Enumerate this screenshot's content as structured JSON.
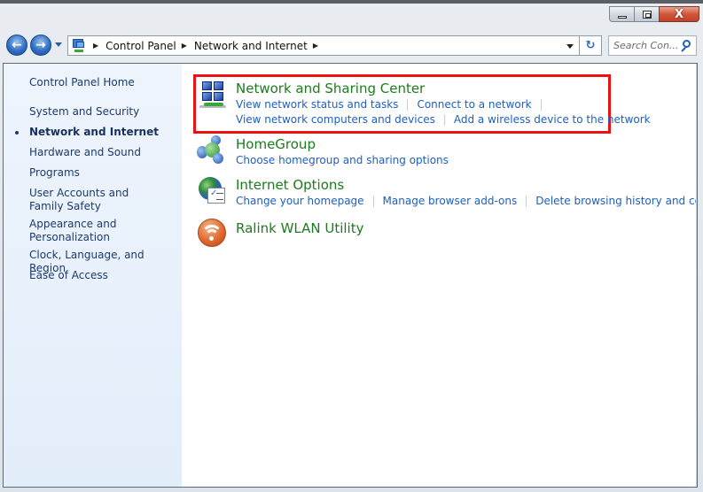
{
  "window": {
    "controls": {
      "minimize_label": "Minimize",
      "maximize_label": "Restore",
      "close_label": "Close",
      "close_glyph": "X"
    }
  },
  "navigation": {
    "back_glyph": "←",
    "forward_glyph": "→",
    "breadcrumb": [
      "Control Panel",
      "Network and Internet"
    ],
    "separator_glyph": "▶",
    "refresh_glyph": "↻",
    "search_placeholder": "Search Con..."
  },
  "sidebar": {
    "items": [
      {
        "label": "Control Panel Home",
        "active": false
      },
      {
        "label": "System and Security",
        "active": false
      },
      {
        "label": "Network and Internet",
        "active": true
      },
      {
        "label": "Hardware and Sound",
        "active": false
      },
      {
        "label": "Programs",
        "active": false
      },
      {
        "label": "User Accounts and Family Safety",
        "active": false
      },
      {
        "label": "Appearance and Personalization",
        "active": false
      },
      {
        "label": "Clock, Language, and Region",
        "active": false
      },
      {
        "label": "Ease of Access",
        "active": false
      }
    ]
  },
  "categories": [
    {
      "title": "Network and Sharing Center",
      "icon": "network-sharing-icon",
      "highlighted": true,
      "task_rows": [
        [
          "View network status and tasks",
          "Connect to a network"
        ],
        [
          "View network computers and devices",
          "Add a wireless device to the network"
        ]
      ]
    },
    {
      "title": "HomeGroup",
      "icon": "homegroup-icon",
      "task_rows": [
        [
          "Choose homegroup and sharing options"
        ]
      ]
    },
    {
      "title": "Internet Options",
      "icon": "internet-options-icon",
      "task_rows": [
        [
          "Change your homepage",
          "Manage browser add-ons",
          "Delete browsing history and cookies"
        ]
      ]
    },
    {
      "title": "Ralink WLAN Utility",
      "icon": "wlan-utility-icon",
      "task_rows": []
    }
  ],
  "colors": {
    "category_title": "#1e7a1e",
    "task_link": "#1e5fbf",
    "highlight_border": "#ee1111",
    "sidebar_bg": "#e8f1fc"
  }
}
